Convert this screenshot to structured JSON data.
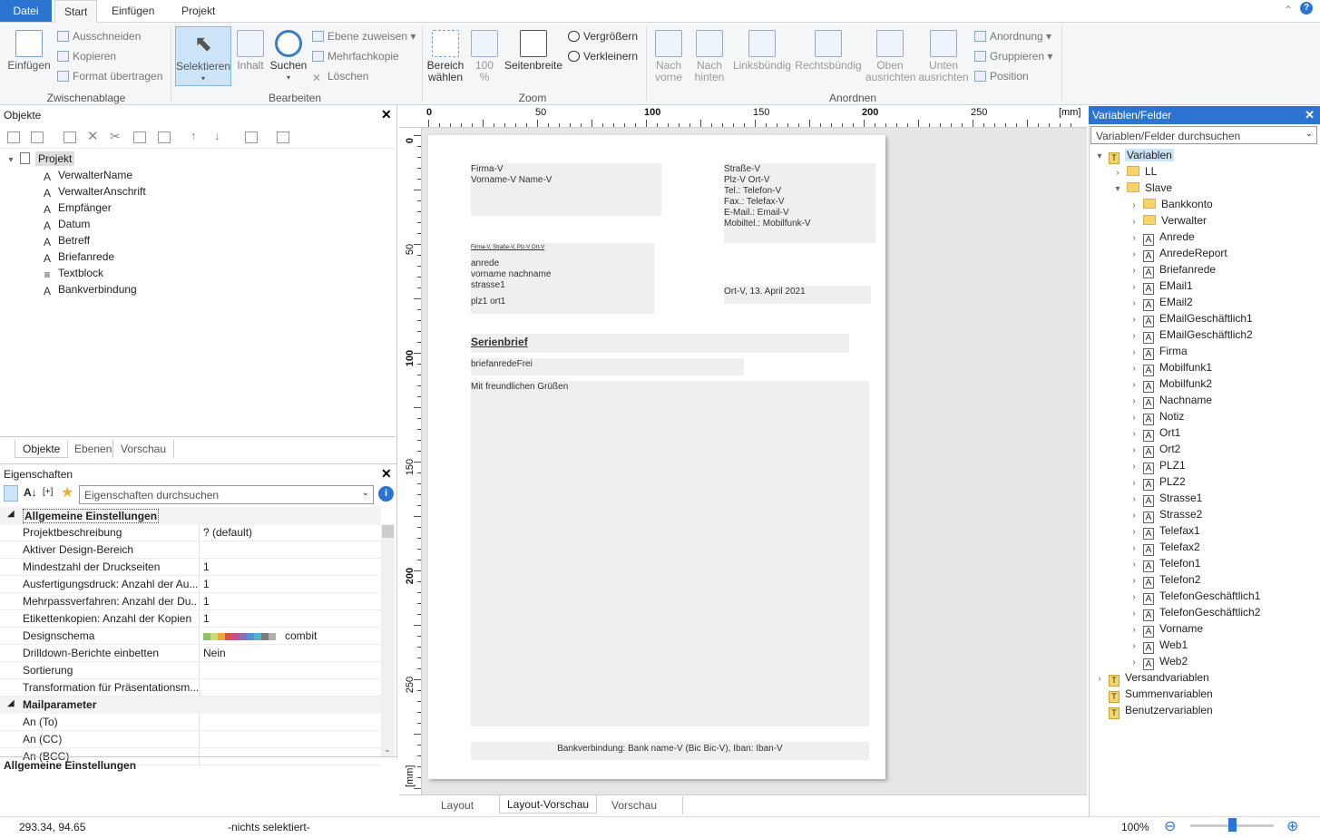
{
  "menu": {
    "file": "Datei",
    "tabs": [
      "Start",
      "Einfügen",
      "Projekt"
    ]
  },
  "ribbon": {
    "clipboard": {
      "paste": "Einfügen",
      "cut": "Ausschneiden",
      "copy": "Kopieren",
      "format": "Format übertragen",
      "label": "Zwischenablage"
    },
    "edit": {
      "select": "Selektieren",
      "content": "Inhalt",
      "search": "Suchen",
      "assign_layer": "Ebene zuweisen",
      "multi_copy": "Mehrfachkopie",
      "delete": "Löschen",
      "label": "Bearbeiten"
    },
    "zoom": {
      "area_select": "Bereich\nwählen",
      "zoom100": "100\n%",
      "page_width": "Seitenbreite",
      "enlarge": "Vergrößern",
      "shrink": "Verkleinern",
      "label": "Zoom"
    },
    "arrange": {
      "front": "Nach\nvorne",
      "back": "Nach\nhinten",
      "left_align": "Linksbündig",
      "right_align": "Rechtsbündig",
      "top_align": "Oben\nausrichten",
      "bottom_align": "Unten\nausrichten",
      "order": "Anordnung",
      "group": "Gruppieren",
      "position": "Position",
      "label": "Anordnen"
    }
  },
  "objects": {
    "title": "Objekte",
    "root": "Projekt",
    "items": [
      "VerwalterName",
      "VerwalterAnschrift",
      "Empfänger",
      "Datum",
      "Betreff",
      "Briefanrede",
      "Textblock",
      "Bankverbindung"
    ],
    "tabs": [
      "Objekte",
      "Ebenen",
      "Vorschau"
    ]
  },
  "properties": {
    "title": "Eigenschaften",
    "search_placeholder": "Eigenschaften durchsuchen",
    "section1": "Allgemeine Einstellungen",
    "rows": [
      {
        "k": "Projektbeschreibung",
        "v": "? (default)"
      },
      {
        "k": "Aktiver Design-Bereich",
        "v": ""
      },
      {
        "k": "Mindestzahl der Druckseiten",
        "v": "1"
      },
      {
        "k": "Ausfertigungsdruck: Anzahl der Au...",
        "v": "1"
      },
      {
        "k": "Mehrpassverfahren: Anzahl der Du...",
        "v": "1"
      },
      {
        "k": "Etikettenkopien: Anzahl der Kopien",
        "v": "1"
      },
      {
        "k": "Designschema",
        "v": "combit"
      },
      {
        "k": "Drilldown-Berichte einbetten",
        "v": "Nein"
      },
      {
        "k": "Sortierung",
        "v": ""
      },
      {
        "k": "Transformation für Präsentationsm...",
        "v": ""
      }
    ],
    "section2": "Mailparameter",
    "rows2": [
      {
        "k": "An (To)",
        "v": ""
      },
      {
        "k": "An (CC)",
        "v": ""
      },
      {
        "k": "An (BCC)",
        "v": ""
      }
    ],
    "footer": "Allgemeine Einstellungen",
    "palette": [
      "#8dc26b",
      "#c5dc7a",
      "#e9a843",
      "#d9544f",
      "#c94f8c",
      "#8d6db5",
      "#5a8ed0",
      "#4cb5c7",
      "#7a7a7a",
      "#b0b0b0"
    ]
  },
  "ruler": {
    "top": [
      "0",
      "50",
      "100",
      "150",
      "200",
      "250",
      "[mm]"
    ],
    "left": [
      "0",
      "50",
      "100",
      "150",
      "200",
      "250",
      "[mm]"
    ]
  },
  "page": {
    "firma": "Firma-V",
    "vorname": "Vorname-V Name-V",
    "strasse": "Straße-V",
    "plzort": "Plz-V Ort-V",
    "tel": "Tel.: Telefon-V",
    "fax": "Fax.: Telefax-V",
    "email": "E-Mail.: Email-V",
    "mobil": "Mobiltel.: Mobilfunk-V",
    "sender_line": "Firma-V, Straße-V, Plz-V Ort-V",
    "anrede": "anrede",
    "vorname_nachname": "vorname nachname",
    "strasse1": "strasse1",
    "plz_ort": "plz1 ort1",
    "date": "Ort-V, 13. April 2021",
    "subject": "Serienbrief",
    "salutation": "briefanredeFrei",
    "body": "Mit freundlichen Grüßen",
    "bank": "Bankverbindung: Bank name-V (Bic Bic-V), Iban: Iban-V"
  },
  "center_tabs": [
    "Layout",
    "Layout-Vorschau",
    "Vorschau"
  ],
  "variables": {
    "title": "Variablen/Felder",
    "search": "Variablen/Felder durchsuchen",
    "root": "Variablen",
    "ll": "LL",
    "slave": "Slave",
    "folders": [
      "Bankkonto",
      "Verwalter"
    ],
    "fields": [
      "Anrede",
      "AnredeReport",
      "Briefanrede",
      "EMail1",
      "EMail2",
      "EMailGeschäftlich1",
      "EMailGeschäftlich2",
      "Firma",
      "Mobilfunk1",
      "Mobilfunk2",
      "Nachname",
      "Notiz",
      "Ort1",
      "Ort2",
      "PLZ1",
      "PLZ2",
      "Strasse1",
      "Strasse2",
      "Telefax1",
      "Telefax2",
      "Telefon1",
      "Telefon2",
      "TelefonGeschäftlich1",
      "TelefonGeschäftlich2",
      "Vorname",
      "Web1",
      "Web2"
    ],
    "others": [
      "Versandvariablen",
      "Summenvariablen",
      "Benutzervariablen"
    ]
  },
  "status": {
    "coords": "293.34, 94.65",
    "selection": "-nichts selektiert-",
    "zoom": "100%"
  }
}
